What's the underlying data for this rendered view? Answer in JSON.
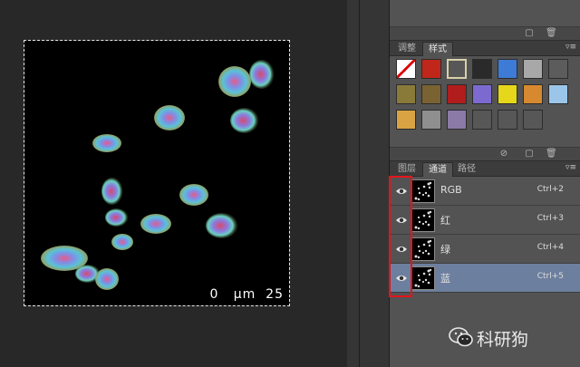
{
  "canvas": {
    "scalebar_text": "0   µm  25"
  },
  "styles_panel": {
    "tabs": [
      "调整",
      "样式"
    ],
    "active_tab": "样式",
    "menu_icon": "panel-menu-icon",
    "swatches": [
      {
        "name": "style-none-swatch",
        "color": "#ffffff"
      },
      {
        "name": "style-red-glow-swatch",
        "color": "#c0261a"
      },
      {
        "name": "style-outline-swatch",
        "color": "#ece6c8"
      },
      {
        "name": "style-dark-bevel-swatch",
        "color": "#2a2a2a"
      },
      {
        "name": "style-blue-bevel-swatch",
        "color": "#3d7bd6"
      },
      {
        "name": "style-gray-swatch",
        "color": "#a8a8a8"
      },
      {
        "name": "style-dark-gray-swatch",
        "color": "#5c5c5c"
      },
      {
        "name": "style-gold-texture-swatch",
        "color": "#8a7a3a"
      },
      {
        "name": "style-brown-swatch",
        "color": "#7a6232"
      },
      {
        "name": "style-red-stripe-swatch",
        "color": "#b11c1c"
      },
      {
        "name": "style-multicolor-swatch",
        "color": "#7d6ad0"
      },
      {
        "name": "style-yellow-swatch",
        "color": "#e6d71a"
      },
      {
        "name": "style-orange-gradient-swatch",
        "color": "#d6892e"
      },
      {
        "name": "style-light-blue-swatch",
        "color": "#9bc6ea"
      },
      {
        "name": "style-sunset-swatch",
        "color": "#d9a243"
      },
      {
        "name": "style-pattern-swatch",
        "color": "#8f8f8f"
      },
      {
        "name": "style-purple-bevel-swatch",
        "color": "#8a7aa8"
      },
      {
        "name": "style-empty-1-swatch",
        "color": "#575757"
      },
      {
        "name": "style-empty-2-swatch",
        "color": "#575757"
      },
      {
        "name": "style-empty-3-swatch",
        "color": "#575757"
      }
    ]
  },
  "channels_panel": {
    "tabs": [
      "图层",
      "通道",
      "路径"
    ],
    "active_tab": "通道",
    "rows": [
      {
        "name": "RGB",
        "shortcut": "Ctrl+2",
        "selected": false
      },
      {
        "name": "红",
        "shortcut": "Ctrl+3",
        "selected": false
      },
      {
        "name": "绿",
        "shortcut": "Ctrl+4",
        "selected": false
      },
      {
        "name": "蓝",
        "shortcut": "Ctrl+5",
        "selected": true
      }
    ]
  },
  "watermark": {
    "text": "科研狗",
    "icon": "wechat-icon"
  }
}
